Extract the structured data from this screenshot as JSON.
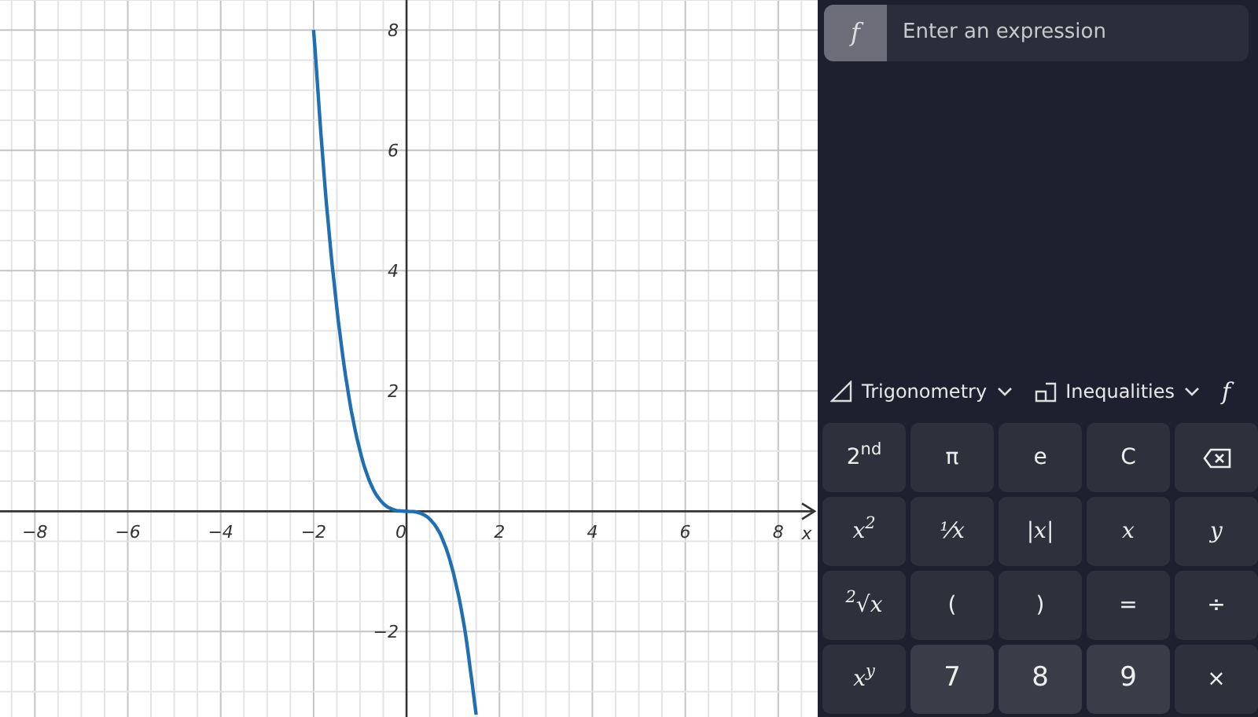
{
  "graph": {
    "chart_data": {
      "type": "line",
      "xlabel": "x",
      "x": [
        -2.0,
        -1.75,
        -1.5,
        -1.25,
        -1.0,
        -0.75,
        -0.5,
        -0.25,
        0,
        0.25,
        0.5,
        0.75,
        1.0,
        1.25,
        1.5
      ],
      "series": [
        {
          "color": "#1f6fb2",
          "values": [
            8.0,
            5.36,
            3.38,
            1.95,
            1.0,
            0.42,
            0.13,
            0.02,
            0,
            -0.02,
            -0.13,
            -0.42,
            -1.0,
            -1.95,
            -3.38
          ]
        }
      ],
      "grid": true,
      "xlim": [
        -8.75,
        8.85
      ],
      "ylim": [
        -3.42,
        8.5
      ],
      "xticks": [
        -8,
        -6,
        -4,
        -2,
        0,
        2,
        4,
        6,
        8
      ],
      "yticks": [
        -2,
        2,
        4,
        6,
        8
      ]
    }
  },
  "expression": {
    "icon": "f",
    "placeholder": "Enter an expression"
  },
  "toolbar": [
    {
      "kind": "trig",
      "label": "Trigonometry"
    },
    {
      "kind": "ineq",
      "label": "Inequalities"
    },
    {
      "kind": "func",
      "label": "f"
    }
  ],
  "keys": [
    {
      "kind": "text",
      "label": "2$^{nd}$"
    },
    {
      "kind": "text",
      "label": "π"
    },
    {
      "kind": "text",
      "label": "e"
    },
    {
      "kind": "text",
      "label": "C"
    },
    {
      "kind": "backspace"
    },
    {
      "kind": "math",
      "label": "x$^{2}$"
    },
    {
      "kind": "math",
      "label": "¹⁄x"
    },
    {
      "kind": "math",
      "label": "|x|"
    },
    {
      "kind": "math",
      "label": "x"
    },
    {
      "kind": "math",
      "label": "y"
    },
    {
      "kind": "math",
      "label": "$^{2}$√x"
    },
    {
      "kind": "text",
      "label": "("
    },
    {
      "kind": "text",
      "label": ")"
    },
    {
      "kind": "text",
      "label": "="
    },
    {
      "kind": "text",
      "label": "÷"
    },
    {
      "kind": "math",
      "label": "x$^{y}$"
    },
    {
      "kind": "text",
      "label": "7"
    },
    {
      "kind": "text",
      "label": "8"
    },
    {
      "kind": "text",
      "label": "9"
    },
    {
      "kind": "text",
      "label": "×"
    }
  ]
}
